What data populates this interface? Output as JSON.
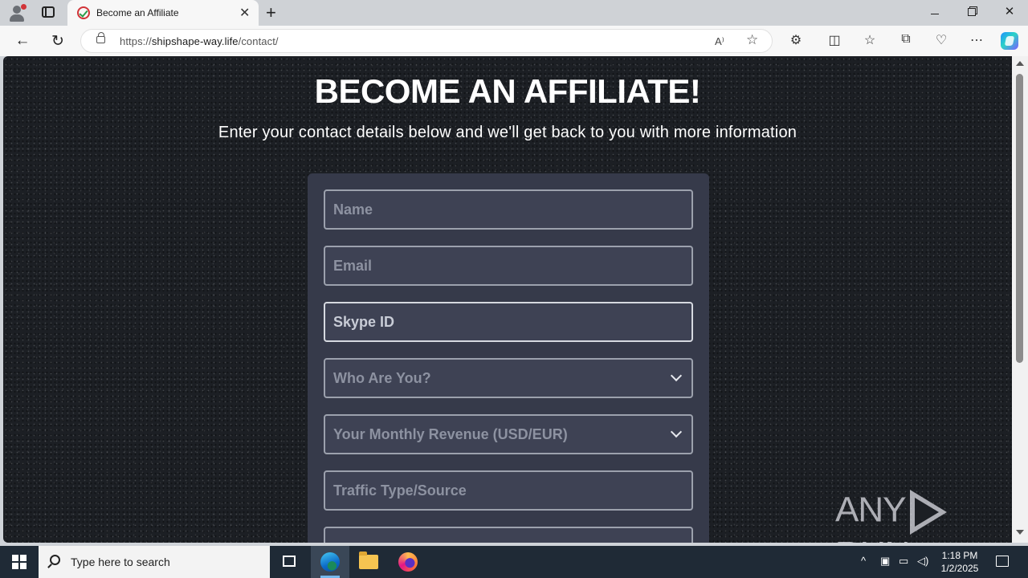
{
  "browser": {
    "tab_title": "Become an Affiliate",
    "tab_close": "✕",
    "new_tab": "+",
    "url_prefix": "https://",
    "url_domain": "shipshape-way.life",
    "url_path": "/contact/",
    "window_close": "✕"
  },
  "page": {
    "heading": "BECOME AN AFFILIATE!",
    "subheading": "Enter your contact details below and we'll get back to you with more information",
    "form": {
      "name_placeholder": "Name",
      "email_placeholder": "Email",
      "skype_placeholder": "Skype ID",
      "who_are_you": "Who Are You?",
      "monthly_revenue": "Your Monthly Revenue (USD/EUR)",
      "traffic_placeholder": "Traffic Type/Source"
    },
    "watermark_left": "ANY",
    "watermark_right": "RUN"
  },
  "taskbar": {
    "search_placeholder": "Type here to search",
    "time": "1:18 PM",
    "date": "1/2/2025"
  }
}
